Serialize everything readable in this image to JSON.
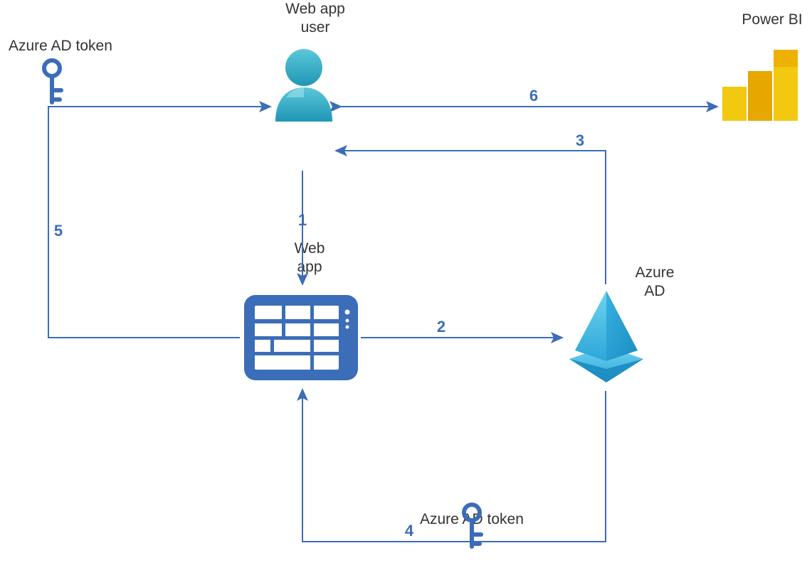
{
  "nodes": {
    "web_app_user": "Web app\nuser",
    "web_app": "Web\napp",
    "azure_ad": "Azure\nAD",
    "power_bi": "Power BI",
    "azure_ad_token_top": "Azure AD token",
    "azure_ad_token_bottom": "Azure AD token"
  },
  "steps": {
    "s1": "1",
    "s2": "2",
    "s3": "3",
    "s4": "4",
    "s5": "5",
    "s6": "6"
  },
  "colors": {
    "arrow": "#3b6db8",
    "step": "#3b6db8",
    "text": "#333333"
  }
}
